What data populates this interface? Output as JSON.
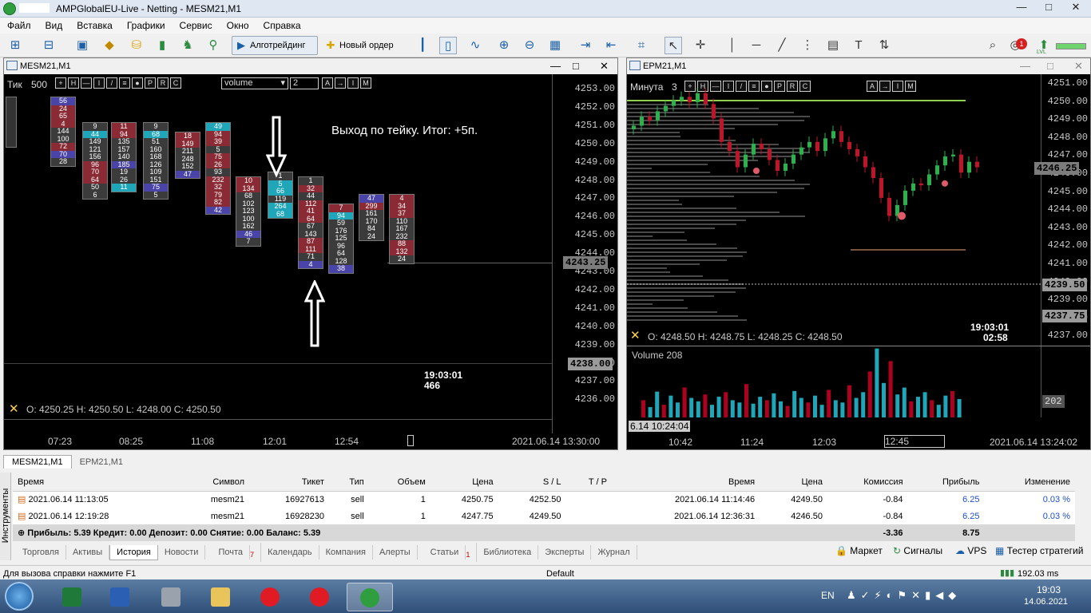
{
  "window": {
    "title": "AMPGlobalEU-Live - Netting - MESM21,M1",
    "minimize": "—",
    "maximize": "□",
    "close": "✕"
  },
  "menu": [
    "Файл",
    "Вид",
    "Вставка",
    "Графики",
    "Сервис",
    "Окно",
    "Справка"
  ],
  "toolbar": {
    "algo_label": "Алготрейдинг",
    "new_order_label": "Новый ордер",
    "notification_count": "1",
    "lvl_label": "LVL"
  },
  "left_chart": {
    "title": "MESM21,M1",
    "mode_label": "Тик",
    "mode_value": "500",
    "dropdown_value": "volume",
    "spin_value": "2",
    "mini_buttons": [
      "+",
      "H",
      "—",
      "I",
      "/",
      "≡",
      "●",
      "P",
      "R",
      "C"
    ],
    "mini_buttons_right": [
      "A",
      "→",
      "I",
      "M"
    ],
    "annotation": "Выход по тейку. Итог: +5п.",
    "ohlc": "O: 4250.25   H: 4250.50   L: 4248.00   C: 4250.50",
    "cursor_time": "19:03:01",
    "cursor_vol": "466",
    "prices": [
      "4253.00",
      "4252.00",
      "4251.00",
      "4250.00",
      "4249.00",
      "4248.00",
      "4247.00",
      "4246.00",
      "4245.00",
      "4244.00",
      "4243.00",
      "4242.00",
      "4241.00",
      "4240.00",
      "4239.00",
      "4238.00",
      "4237.00",
      "4236.00"
    ],
    "price_tag_current": "4243.25",
    "price_tag_low": "4238.00",
    "time_labels": [
      "07:23",
      "08:25",
      "11:08",
      "12:01",
      "12:54"
    ],
    "time_footer": "2021.06.14 13:30:00",
    "clusters": [
      {
        "cells": [
          [
            "56",
            "c-blue"
          ],
          [
            "24",
            "c-red"
          ],
          [
            "65",
            "c-red"
          ],
          [
            "4",
            "c-red"
          ],
          [
            "144",
            "c-grey"
          ],
          [
            "100",
            "c-grey"
          ],
          [
            "72",
            "c-red"
          ],
          [
            "70",
            "c-blue"
          ],
          [
            "28",
            "c-grey"
          ]
        ]
      },
      {
        "cells": [
          [
            "9",
            "c-grey"
          ],
          [
            "44",
            "c-teal"
          ],
          [
            "149",
            "c-grey"
          ],
          [
            "121",
            "c-grey"
          ],
          [
            "156",
            "c-grey"
          ],
          [
            "96",
            "c-red"
          ],
          [
            "70",
            "c-red"
          ],
          [
            "64",
            "c-red"
          ],
          [
            "50",
            "c-grey"
          ],
          [
            "6",
            "c-grey"
          ]
        ]
      },
      {
        "cells": [
          [
            "11",
            "c-red"
          ],
          [
            "94",
            "c-red"
          ],
          [
            "135",
            "c-grey"
          ],
          [
            "157",
            "c-grey"
          ],
          [
            "140",
            "c-grey"
          ],
          [
            "185",
            "c-blue"
          ],
          [
            "19",
            "c-grey"
          ],
          [
            "26",
            "c-grey"
          ],
          [
            "11",
            "c-teal"
          ]
        ]
      },
      {
        "cells": [
          [
            "9",
            "c-grey"
          ],
          [
            "68",
            "c-teal"
          ],
          [
            "51",
            "c-grey"
          ],
          [
            "160",
            "c-grey"
          ],
          [
            "168",
            "c-grey"
          ],
          [
            "126",
            "c-grey"
          ],
          [
            "109",
            "c-grey"
          ],
          [
            "151",
            "c-grey"
          ],
          [
            "75",
            "c-blue"
          ],
          [
            "5",
            "c-grey"
          ]
        ]
      },
      {
        "cells": [
          [
            "18",
            "c-red"
          ],
          [
            "149",
            "c-red"
          ],
          [
            "211",
            "c-grey"
          ],
          [
            "248",
            "c-grey"
          ],
          [
            "152",
            "c-grey"
          ],
          [
            "47",
            "c-blue"
          ]
        ]
      },
      {
        "cells": [
          [
            "49",
            "c-teal"
          ],
          [
            "94",
            "c-red"
          ],
          [
            "39",
            "c-red"
          ],
          [
            "5",
            "c-grey"
          ],
          [
            "75",
            "c-red"
          ],
          [
            "26",
            "c-red"
          ],
          [
            "93",
            "c-grey"
          ],
          [
            "232",
            "c-red"
          ],
          [
            "32",
            "c-red"
          ],
          [
            "79",
            "c-red"
          ],
          [
            "82",
            "c-red"
          ],
          [
            "42",
            "c-blue"
          ]
        ]
      },
      {
        "cells": [
          [
            "10",
            "c-red"
          ],
          [
            "134",
            "c-red"
          ],
          [
            "68",
            "c-grey"
          ],
          [
            "102",
            "c-grey"
          ],
          [
            "123",
            "c-grey"
          ],
          [
            "100",
            "c-grey"
          ],
          [
            "162",
            "c-grey"
          ],
          [
            "46",
            "c-blue"
          ],
          [
            "7",
            "c-grey"
          ]
        ]
      },
      {
        "cells": [
          [
            "1",
            "c-grey"
          ],
          [
            "5",
            "c-teal"
          ],
          [
            "66",
            "c-teal"
          ],
          [
            "119",
            "c-grey"
          ],
          [
            "264",
            "c-teal"
          ],
          [
            "68",
            "c-teal"
          ]
        ]
      },
      {
        "cells": [
          [
            "1",
            "c-grey"
          ],
          [
            "32",
            "c-red"
          ],
          [
            "44",
            "c-grey"
          ],
          [
            "112",
            "c-red"
          ],
          [
            "41",
            "c-red"
          ],
          [
            "64",
            "c-red"
          ],
          [
            "67",
            "c-grey"
          ],
          [
            "143",
            "c-grey"
          ],
          [
            "87",
            "c-red"
          ],
          [
            "111",
            "c-red"
          ],
          [
            "71",
            "c-grey"
          ],
          [
            "4",
            "c-blue"
          ]
        ]
      },
      {
        "cells": [
          [
            "7",
            "c-red"
          ],
          [
            "94",
            "c-teal"
          ],
          [
            "59",
            "c-grey"
          ],
          [
            "176",
            "c-grey"
          ],
          [
            "125",
            "c-grey"
          ],
          [
            "96",
            "c-grey"
          ],
          [
            "64",
            "c-grey"
          ],
          [
            "128",
            "c-grey"
          ],
          [
            "38",
            "c-blue"
          ]
        ]
      },
      {
        "cells": [
          [
            "47",
            "c-blue"
          ],
          [
            "299",
            "c-red"
          ],
          [
            "161",
            "c-grey"
          ],
          [
            "170",
            "c-grey"
          ],
          [
            "84",
            "c-grey"
          ],
          [
            "24",
            "c-grey"
          ]
        ]
      },
      {
        "cells": [
          [
            "4",
            "c-red"
          ],
          [
            "34",
            "c-red"
          ],
          [
            "37",
            "c-red"
          ],
          [
            "110",
            "c-grey"
          ],
          [
            "167",
            "c-grey"
          ],
          [
            "232",
            "c-grey"
          ],
          [
            "88",
            "c-red"
          ],
          [
            "132",
            "c-red"
          ],
          [
            "24",
            "c-grey"
          ]
        ]
      }
    ]
  },
  "right_chart": {
    "title": "EPM21,M1",
    "mode_label": "Минута",
    "mode_value": "3",
    "mini_buttons": [
      "+",
      "H",
      "—",
      "I",
      "/",
      "≡",
      "●",
      "P",
      "R",
      "C"
    ],
    "mini_buttons_right": [
      "A",
      "→",
      "I",
      "M"
    ],
    "ohlc": "O: 4248.50   H: 4248.75   L: 4248.25   C: 4248.50",
    "cursor_time": "19:03:01",
    "cursor_sub": "02:58",
    "prices": [
      "4251.00",
      "4250.00",
      "4249.00",
      "4248.00",
      "4247.00",
      "4246.00",
      "4245.00",
      "4244.00",
      "4243.00",
      "4242.00",
      "4241.00",
      "4240.00",
      "4239.00",
      "4238.00",
      "4237.00"
    ],
    "price_tag_current": "4246.25",
    "price_tag_mid": "4239.50",
    "price_tag_low": "4237.75",
    "volume_label": "Volume 208",
    "volume_tag": "202",
    "time_labels": [
      "10:42",
      "11:24",
      "12:03",
      "12:45"
    ],
    "time_left": "6.14 10:24:04",
    "time_footer": "2021.06.14 13:24:02"
  },
  "terminal": {
    "tabs_top": [
      "MESM21,M1",
      "EPM21,M1"
    ],
    "columns": [
      "Время",
      "Символ",
      "Тикет",
      "Тип",
      "Объем",
      "Цена",
      "S / L",
      "T / P",
      "Время",
      "Цена",
      "Комиссия",
      "Прибыль",
      "Изменение"
    ],
    "rows": [
      [
        "2021.06.14 11:13:05",
        "mesm21",
        "16927613",
        "sell",
        "1",
        "4250.75",
        "4252.50",
        "",
        "2021.06.14 11:14:46",
        "4249.50",
        "-0.84",
        "6.25",
        "0.03 %"
      ],
      [
        "2021.06.14 12:19:28",
        "mesm21",
        "16928230",
        "sell",
        "1",
        "4247.75",
        "4249.50",
        "",
        "2021.06.14 12:36:31",
        "4246.50",
        "-0.84",
        "6.25",
        "0.03 %"
      ]
    ],
    "summary": "Прибыль: 5.39  Кредит: 0.00  Депозит: 0.00  Снятие: 0.00  Баланс: 5.39",
    "summary_commission": "-3.36",
    "summary_profit": "8.75",
    "side_label": "Инструменты",
    "bottom_tabs": [
      "Торговля",
      "Активы",
      "История",
      "Новости",
      "Почта",
      "Календарь",
      "Компания",
      "Алерты",
      "Статьи",
      "Библиотека",
      "Эксперты",
      "Журнал"
    ],
    "mail_badge": "7",
    "articles_badge": "1",
    "right_tabs": [
      "Маркет",
      "Сигналы",
      "VPS",
      "Тестер стратегий"
    ]
  },
  "status": {
    "help": "Для вызова справки нажмите F1",
    "profile": "Default",
    "ping": "192.03 ms"
  },
  "taskbar": {
    "lang": "EN",
    "time": "19:03",
    "date": "14.06.2021"
  },
  "colors": {
    "bull": "#2bb24c",
    "bear": "#c0142a",
    "teal": "#1fa6b8",
    "vol_bear": "#b00020"
  }
}
